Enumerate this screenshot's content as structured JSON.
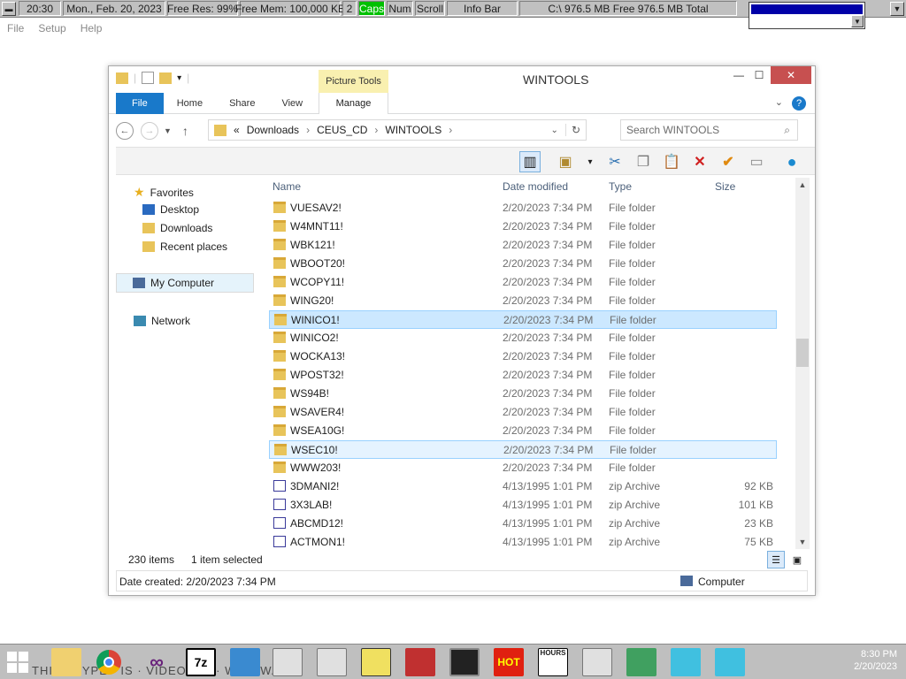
{
  "infobar": {
    "time": "20:30",
    "date": "Mon., Feb. 20, 2023",
    "free_res": "Free Res: 99%",
    "free_mem": "Free Mem: 100,000 KB",
    "num2": "2",
    "caps": "Caps",
    "num": "Num",
    "scroll": "Scroll",
    "info_bar": "Info Bar",
    "disk": "C:\\ 976.5 MB Free  976.5 MB Total",
    "caps_color": "#00c000"
  },
  "menubar": {
    "items": [
      "File",
      "Setup",
      "Help"
    ]
  },
  "explorer": {
    "title": "WINTOOLS",
    "picture_tools": "Picture Tools",
    "ribbon_tabs": [
      "File",
      "Home",
      "Share",
      "View"
    ],
    "manage": "Manage",
    "address": {
      "root": "«",
      "crumbs": [
        "Downloads",
        "CEUS_CD",
        "WINTOOLS"
      ]
    },
    "search_placeholder": "Search WINTOOLS",
    "nav": {
      "favorites": "Favorites",
      "desktop": "Desktop",
      "downloads": "Downloads",
      "recent": "Recent places",
      "my_computer": "My Computer",
      "network": "Network"
    },
    "columns": [
      "Name",
      "Date modified",
      "Type",
      "Size"
    ],
    "rows": [
      {
        "name": "VUESAV2!",
        "date": "2/20/2023 7:34 PM",
        "type": "File folder",
        "size": "",
        "kind": "folder"
      },
      {
        "name": "W4MNT11!",
        "date": "2/20/2023 7:34 PM",
        "type": "File folder",
        "size": "",
        "kind": "folder"
      },
      {
        "name": "WBK121!",
        "date": "2/20/2023 7:34 PM",
        "type": "File folder",
        "size": "",
        "kind": "folder"
      },
      {
        "name": "WBOOT20!",
        "date": "2/20/2023 7:34 PM",
        "type": "File folder",
        "size": "",
        "kind": "folder"
      },
      {
        "name": "WCOPY11!",
        "date": "2/20/2023 7:34 PM",
        "type": "File folder",
        "size": "",
        "kind": "folder"
      },
      {
        "name": "WING20!",
        "date": "2/20/2023 7:34 PM",
        "type": "File folder",
        "size": "",
        "kind": "folder"
      },
      {
        "name": "WINICO1!",
        "date": "2/20/2023 7:34 PM",
        "type": "File folder",
        "size": "",
        "kind": "folder",
        "state": "sel"
      },
      {
        "name": "WINICO2!",
        "date": "2/20/2023 7:34 PM",
        "type": "File folder",
        "size": "",
        "kind": "folder"
      },
      {
        "name": "WOCKA13!",
        "date": "2/20/2023 7:34 PM",
        "type": "File folder",
        "size": "",
        "kind": "folder"
      },
      {
        "name": "WPOST32!",
        "date": "2/20/2023 7:34 PM",
        "type": "File folder",
        "size": "",
        "kind": "folder"
      },
      {
        "name": "WS94B!",
        "date": "2/20/2023 7:34 PM",
        "type": "File folder",
        "size": "",
        "kind": "folder"
      },
      {
        "name": "WSAVER4!",
        "date": "2/20/2023 7:34 PM",
        "type": "File folder",
        "size": "",
        "kind": "folder"
      },
      {
        "name": "WSEA10G!",
        "date": "2/20/2023 7:34 PM",
        "type": "File folder",
        "size": "",
        "kind": "folder"
      },
      {
        "name": "WSEC10!",
        "date": "2/20/2023 7:34 PM",
        "type": "File folder",
        "size": "",
        "kind": "folder",
        "state": "hl"
      },
      {
        "name": "WWW203!",
        "date": "2/20/2023 7:34 PM",
        "type": "File folder",
        "size": "",
        "kind": "folder"
      },
      {
        "name": "3DMANI2!",
        "date": "4/13/1995 1:01 PM",
        "type": "zip Archive",
        "size": "92 KB",
        "kind": "zip"
      },
      {
        "name": "3X3LAB!",
        "date": "4/13/1995 1:01 PM",
        "type": "zip Archive",
        "size": "101 KB",
        "kind": "zip"
      },
      {
        "name": "ABCMD12!",
        "date": "4/13/1995 1:01 PM",
        "type": "zip Archive",
        "size": "23 KB",
        "kind": "zip"
      },
      {
        "name": "ACTMON1!",
        "date": "4/13/1995 1:01 PM",
        "type": "zip Archive",
        "size": "75 KB",
        "kind": "zip"
      }
    ],
    "status": {
      "count": "230 items",
      "selected": "1 item selected"
    },
    "details": {
      "created": "Date created: 2/20/2023 7:34 PM",
      "location": "Computer"
    }
  },
  "taskbar": {
    "apps": [
      "file-explorer",
      "chrome",
      "visual-studio",
      "7zip",
      "remote-desktop",
      "window",
      "window",
      "floppy",
      "paint",
      "terminal",
      "hot",
      "hours-counter",
      "window",
      "exit",
      "fish",
      "fish"
    ],
    "labels": {
      "zip": "7z",
      "hot": "HOT",
      "hours": "HOURS"
    },
    "clock_time": "8:30 PM",
    "clock_date": "2/20/2023"
  }
}
